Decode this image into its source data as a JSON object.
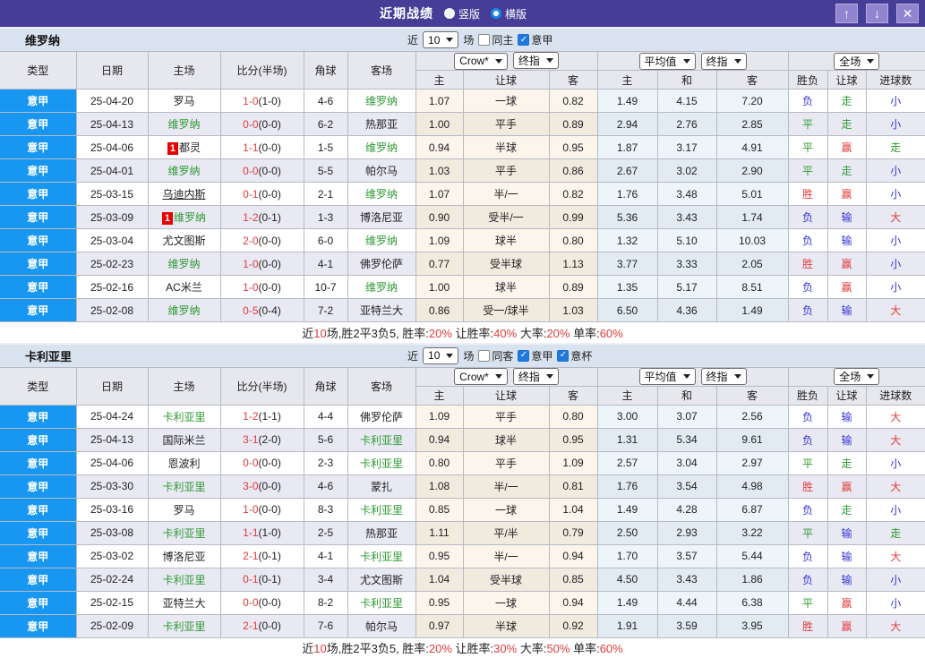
{
  "titlebar": {
    "title": "近期战绩",
    "vertical": "竖版",
    "vertical_checked": false,
    "horizontal": "横版",
    "horizontal_checked": true
  },
  "columns": {
    "type": "类型",
    "date": "日期",
    "home": "主场",
    "score": "比分(半场)",
    "corner": "角球",
    "away": "客场",
    "sub": [
      "主",
      "让球",
      "客",
      "主",
      "和",
      "客",
      "胜负",
      "让球",
      "进球数"
    ]
  },
  "colors": {
    "accent": "#463d96",
    "league_blue": "#1897f2",
    "win_red": "#e03c3c",
    "draw_green": "#2f9933",
    "lose_blue": "#3434d3"
  },
  "sections": [
    {
      "team": "维罗纳",
      "controls": {
        "near": "近",
        "count": "10",
        "games": "场",
        "checks": [
          {
            "name": "same-home-checkbox",
            "label": "同主",
            "checked": false
          },
          {
            "name": "serie-a-checkbox",
            "label": "意甲",
            "checked": true
          }
        ]
      },
      "dropdowns": {
        "company": "Crow*",
        "final1": "终指",
        "average": "平均值",
        "final2": "终指",
        "scope": "全场"
      },
      "rows": [
        {
          "lg": "意甲",
          "date": "25-04-20",
          "home": "罗马",
          "hg": false,
          "hr": false,
          "hu": false,
          "ft": "1-0",
          "ht": "(1-0)",
          "cor": "4-6",
          "away": "维罗纳",
          "ag": true,
          "odds": [
            "1.07",
            "一球",
            "0.82",
            "1.49",
            "4.15",
            "7.20"
          ],
          "res": [
            "负",
            "走",
            "小"
          ]
        },
        {
          "lg": "意甲",
          "date": "25-04-13",
          "home": "维罗纳",
          "hg": true,
          "hr": false,
          "hu": false,
          "ft": "0-0",
          "ht": "(0-0)",
          "cor": "6-2",
          "away": "热那亚",
          "ag": false,
          "odds": [
            "1.00",
            "平手",
            "0.89",
            "2.94",
            "2.76",
            "2.85"
          ],
          "res": [
            "平",
            "走",
            "小"
          ]
        },
        {
          "lg": "意甲",
          "date": "25-04-06",
          "home": "都灵",
          "hg": false,
          "hr": true,
          "hu": false,
          "ft": "1-1",
          "ht": "(0-0)",
          "cor": "1-5",
          "away": "维罗纳",
          "ag": true,
          "odds": [
            "0.94",
            "半球",
            "0.95",
            "1.87",
            "3.17",
            "4.91"
          ],
          "res": [
            "平",
            "赢",
            "走"
          ]
        },
        {
          "lg": "意甲",
          "date": "25-04-01",
          "home": "维罗纳",
          "hg": true,
          "hr": false,
          "hu": false,
          "ft": "0-0",
          "ht": "(0-0)",
          "cor": "5-5",
          "away": "帕尔马",
          "ag": false,
          "odds": [
            "1.03",
            "平手",
            "0.86",
            "2.67",
            "3.02",
            "2.90"
          ],
          "res": [
            "平",
            "走",
            "小"
          ]
        },
        {
          "lg": "意甲",
          "date": "25-03-15",
          "home": "乌迪内斯",
          "hg": false,
          "hr": false,
          "hu": true,
          "ft": "0-1",
          "ht": "(0-0)",
          "cor": "2-1",
          "away": "维罗纳",
          "ag": true,
          "odds": [
            "1.07",
            "半/一",
            "0.82",
            "1.76",
            "3.48",
            "5.01"
          ],
          "res": [
            "胜",
            "赢",
            "小"
          ]
        },
        {
          "lg": "意甲",
          "date": "25-03-09",
          "home": "维罗纳",
          "hg": true,
          "hr": true,
          "hu": false,
          "ft": "1-2",
          "ht": "(0-1)",
          "cor": "1-3",
          "away": "博洛尼亚",
          "ag": false,
          "odds": [
            "0.90",
            "受半/一",
            "0.99",
            "5.36",
            "3.43",
            "1.74"
          ],
          "res": [
            "负",
            "输",
            "大"
          ]
        },
        {
          "lg": "意甲",
          "date": "25-03-04",
          "home": "尤文图斯",
          "hg": false,
          "hr": false,
          "hu": false,
          "ft": "2-0",
          "ht": "(0-0)",
          "cor": "6-0",
          "away": "维罗纳",
          "ag": true,
          "odds": [
            "1.09",
            "球半",
            "0.80",
            "1.32",
            "5.10",
            "10.03"
          ],
          "res": [
            "负",
            "输",
            "小"
          ]
        },
        {
          "lg": "意甲",
          "date": "25-02-23",
          "home": "维罗纳",
          "hg": true,
          "hr": false,
          "hu": false,
          "ft": "1-0",
          "ht": "(0-0)",
          "cor": "4-1",
          "away": "佛罗伦萨",
          "ag": false,
          "odds": [
            "0.77",
            "受半球",
            "1.13",
            "3.77",
            "3.33",
            "2.05"
          ],
          "res": [
            "胜",
            "赢",
            "小"
          ]
        },
        {
          "lg": "意甲",
          "date": "25-02-16",
          "home": "AC米兰",
          "hg": false,
          "hr": false,
          "hu": false,
          "ft": "1-0",
          "ht": "(0-0)",
          "cor": "10-7",
          "away": "维罗纳",
          "ag": true,
          "odds": [
            "1.00",
            "球半",
            "0.89",
            "1.35",
            "5.17",
            "8.51"
          ],
          "res": [
            "负",
            "赢",
            "小"
          ]
        },
        {
          "lg": "意甲",
          "date": "25-02-08",
          "home": "维罗纳",
          "hg": true,
          "hr": false,
          "hu": false,
          "ft": "0-5",
          "ht": "(0-4)",
          "cor": "7-2",
          "away": "亚特兰大",
          "ag": false,
          "odds": [
            "0.86",
            "受一/球半",
            "1.03",
            "6.50",
            "4.36",
            "1.49"
          ],
          "res": [
            "负",
            "输",
            "大"
          ]
        }
      ],
      "summary": [
        [
          "近",
          0
        ],
        [
          "10",
          1
        ],
        [
          "场,胜2平3负5, 胜率:",
          0
        ],
        [
          "20%",
          1
        ],
        [
          " 让胜率:",
          0
        ],
        [
          "40%",
          1
        ],
        [
          " 大率:",
          0
        ],
        [
          "20%",
          1
        ],
        [
          " 单率:",
          0
        ],
        [
          "60%",
          1
        ]
      ]
    },
    {
      "team": "卡利亚里",
      "controls": {
        "near": "近",
        "count": "10",
        "games": "场",
        "checks": [
          {
            "name": "same-away-checkbox",
            "label": "同客",
            "checked": false
          },
          {
            "name": "serie-a-checkbox",
            "label": "意甲",
            "checked": true
          },
          {
            "name": "coppa-italia-checkbox",
            "label": "意杯",
            "checked": true
          }
        ]
      },
      "dropdowns": {
        "company": "Crow*",
        "final1": "终指",
        "average": "平均值",
        "final2": "终指",
        "scope": "全场"
      },
      "rows": [
        {
          "lg": "意甲",
          "date": "25-04-24",
          "home": "卡利亚里",
          "hg": true,
          "hr": false,
          "hu": false,
          "ft": "1-2",
          "ht": "(1-1)",
          "cor": "4-4",
          "away": "佛罗伦萨",
          "ag": false,
          "odds": [
            "1.09",
            "平手",
            "0.80",
            "3.00",
            "3.07",
            "2.56"
          ],
          "res": [
            "负",
            "输",
            "大"
          ]
        },
        {
          "lg": "意甲",
          "date": "25-04-13",
          "home": "国际米兰",
          "hg": false,
          "hr": false,
          "hu": false,
          "ft": "3-1",
          "ht": "(2-0)",
          "cor": "5-6",
          "away": "卡利亚里",
          "ag": true,
          "odds": [
            "0.94",
            "球半",
            "0.95",
            "1.31",
            "5.34",
            "9.61"
          ],
          "res": [
            "负",
            "输",
            "大"
          ]
        },
        {
          "lg": "意甲",
          "date": "25-04-06",
          "home": "恩波利",
          "hg": false,
          "hr": false,
          "hu": false,
          "ft": "0-0",
          "ht": "(0-0)",
          "cor": "2-3",
          "away": "卡利亚里",
          "ag": true,
          "odds": [
            "0.80",
            "平手",
            "1.09",
            "2.57",
            "3.04",
            "2.97"
          ],
          "res": [
            "平",
            "走",
            "小"
          ]
        },
        {
          "lg": "意甲",
          "date": "25-03-30",
          "home": "卡利亚里",
          "hg": true,
          "hr": false,
          "hu": false,
          "ft": "3-0",
          "ht": "(0-0)",
          "cor": "4-6",
          "away": "蒙扎",
          "ag": false,
          "odds": [
            "1.08",
            "半/一",
            "0.81",
            "1.76",
            "3.54",
            "4.98"
          ],
          "res": [
            "胜",
            "赢",
            "大"
          ]
        },
        {
          "lg": "意甲",
          "date": "25-03-16",
          "home": "罗马",
          "hg": false,
          "hr": false,
          "hu": false,
          "ft": "1-0",
          "ht": "(0-0)",
          "cor": "8-3",
          "away": "卡利亚里",
          "ag": true,
          "odds": [
            "0.85",
            "一球",
            "1.04",
            "1.49",
            "4.28",
            "6.87"
          ],
          "res": [
            "负",
            "走",
            "小"
          ]
        },
        {
          "lg": "意甲",
          "date": "25-03-08",
          "home": "卡利亚里",
          "hg": true,
          "hr": false,
          "hu": false,
          "ft": "1-1",
          "ht": "(1-0)",
          "cor": "2-5",
          "away": "热那亚",
          "ag": false,
          "odds": [
            "1.11",
            "平/半",
            "0.79",
            "2.50",
            "2.93",
            "3.22"
          ],
          "res": [
            "平",
            "输",
            "走"
          ]
        },
        {
          "lg": "意甲",
          "date": "25-03-02",
          "home": "博洛尼亚",
          "hg": false,
          "hr": false,
          "hu": false,
          "ft": "2-1",
          "ht": "(0-1)",
          "cor": "4-1",
          "away": "卡利亚里",
          "ag": true,
          "odds": [
            "0.95",
            "半/一",
            "0.94",
            "1.70",
            "3.57",
            "5.44"
          ],
          "res": [
            "负",
            "输",
            "大"
          ]
        },
        {
          "lg": "意甲",
          "date": "25-02-24",
          "home": "卡利亚里",
          "hg": true,
          "hr": false,
          "hu": false,
          "ft": "0-1",
          "ht": "(0-1)",
          "cor": "3-4",
          "away": "尤文图斯",
          "ag": false,
          "odds": [
            "1.04",
            "受半球",
            "0.85",
            "4.50",
            "3.43",
            "1.86"
          ],
          "res": [
            "负",
            "输",
            "小"
          ]
        },
        {
          "lg": "意甲",
          "date": "25-02-15",
          "home": "亚特兰大",
          "hg": false,
          "hr": false,
          "hu": false,
          "ft": "0-0",
          "ht": "(0-0)",
          "cor": "8-2",
          "away": "卡利亚里",
          "ag": true,
          "odds": [
            "0.95",
            "一球",
            "0.94",
            "1.49",
            "4.44",
            "6.38"
          ],
          "res": [
            "平",
            "赢",
            "小"
          ]
        },
        {
          "lg": "意甲",
          "date": "25-02-09",
          "home": "卡利亚里",
          "hg": true,
          "hr": false,
          "hu": false,
          "ft": "2-1",
          "ht": "(0-0)",
          "cor": "7-6",
          "away": "帕尔马",
          "ag": false,
          "odds": [
            "0.97",
            "半球",
            "0.92",
            "1.91",
            "3.59",
            "3.95"
          ],
          "res": [
            "胜",
            "赢",
            "大"
          ]
        }
      ],
      "summary": [
        [
          "近",
          0
        ],
        [
          "10",
          1
        ],
        [
          "场,胜2平3负5, 胜率:",
          0
        ],
        [
          "20%",
          1
        ],
        [
          " 让胜率:",
          0
        ],
        [
          "30%",
          1
        ],
        [
          " 大率:",
          0
        ],
        [
          "50%",
          1
        ],
        [
          " 单率:",
          0
        ],
        [
          "60%",
          1
        ]
      ]
    }
  ]
}
